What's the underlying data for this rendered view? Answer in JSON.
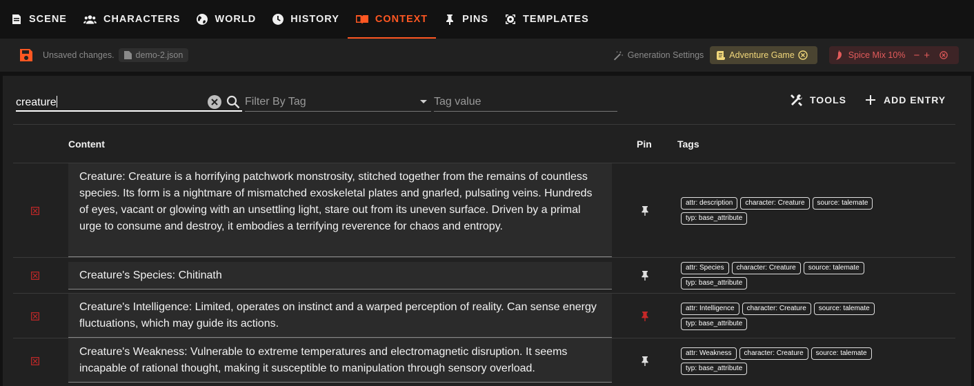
{
  "nav": {
    "tabs": [
      {
        "label": "SCENE",
        "icon": "scene-icon"
      },
      {
        "label": "CHARACTERS",
        "icon": "characters-icon"
      },
      {
        "label": "WORLD",
        "icon": "world-icon"
      },
      {
        "label": "HISTORY",
        "icon": "history-icon"
      },
      {
        "label": "CONTEXT",
        "icon": "context-icon",
        "active": true
      },
      {
        "label": "PINS",
        "icon": "pin-icon"
      },
      {
        "label": "TEMPLATES",
        "icon": "templates-icon"
      }
    ],
    "active_color": "#ff5722"
  },
  "status": {
    "unsaved_text": "Unsaved changes.",
    "file_name": "demo-2.json",
    "generation_settings_label": "Generation Settings",
    "preset_label": "Adventure Game",
    "spice_label": "Spice Mix 10%",
    "spice_minus": "−",
    "spice_plus": "+"
  },
  "filters": {
    "search_value": "creature",
    "tag_filter_placeholder": "Filter By Tag",
    "tag_value_placeholder": "Tag value"
  },
  "toolbar": {
    "tools_label": "TOOLS",
    "add_entry_label": "ADD ENTRY"
  },
  "table": {
    "headers": {
      "content": "Content",
      "pin": "Pin",
      "tags": "Tags"
    },
    "rows": [
      {
        "content": "Creature: Creature is a horrifying patchwork monstrosity, stitched together from the remains of countless species.  Its form is a nightmare of mismatched exoskeletal plates and gnarled, pulsating veins.  Hundreds of eyes, vacant or glowing with an unsettling light, stare out from its uneven surface. Driven by a primal urge to consume and destroy, it embodies a terrifying reverence for chaos and entropy.",
        "pinned": false,
        "tags": [
          "attr: description",
          "character: Creature",
          "source: talemate",
          "typ: base_attribute"
        ]
      },
      {
        "content": "Creature's Species: Chitinath",
        "pinned": false,
        "tags": [
          "attr: Species",
          "character: Creature",
          "source: talemate",
          "typ: base_attribute"
        ]
      },
      {
        "content": "Creature's Intelligence: Limited, operates on instinct and a warped perception of reality. Can sense energy fluctuations, which may guide its actions.",
        "pinned": true,
        "tags": [
          "attr: Intelligence",
          "character: Creature",
          "source: talemate",
          "typ: base_attribute"
        ]
      },
      {
        "content": "Creature's Weakness: Vulnerable to extreme temperatures and electromagnetic disruption. It seems incapable of rational thought, making it susceptible to manipulation through sensory overload.",
        "pinned": false,
        "tags": [
          "attr: Weakness",
          "character: Creature",
          "source: talemate",
          "typ: base_attribute"
        ]
      }
    ]
  },
  "colors": {
    "delete_icon": "#c62828",
    "pin_active": "#c62828",
    "pin_inactive": "#e0e0e0",
    "preset_chip_text": "#f1d77a",
    "spice_chip_text": "#e35b5b"
  }
}
